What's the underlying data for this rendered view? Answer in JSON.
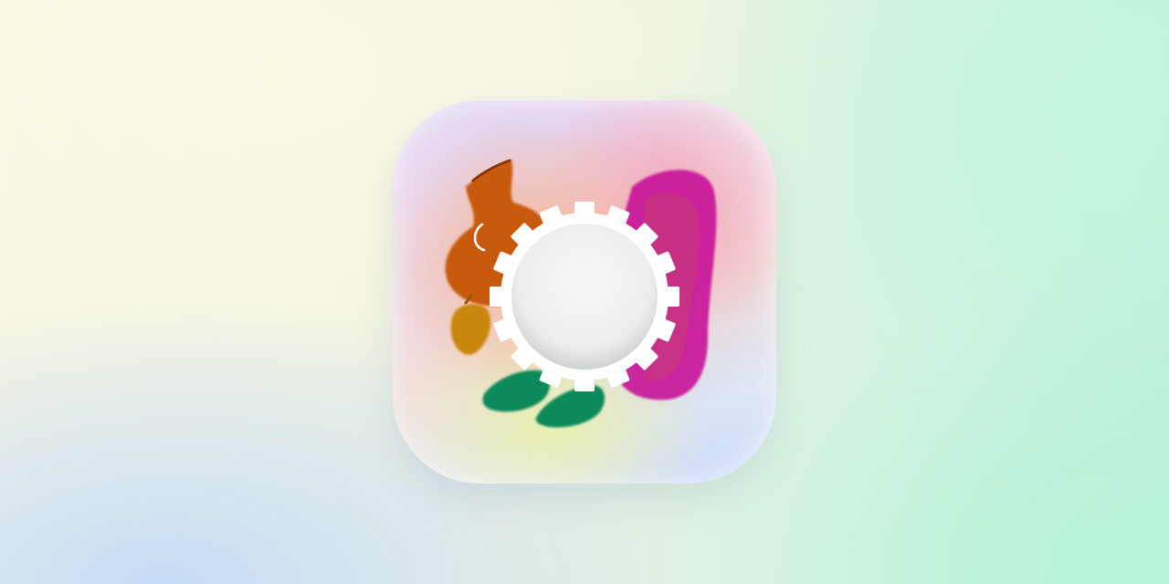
{
  "scene": {
    "background_colors": [
      "#f8f6e2",
      "#c6dcf6",
      "#b9eedb"
    ]
  },
  "app_icon": {
    "icon": "app-icon-squircle",
    "colors": {
      "body_orange": "#c85a0c",
      "wing_magenta": "#c8189a",
      "feet_green": "#0e8a5a",
      "acorn_gold": "#c9880a",
      "gear_white": "#ffffff",
      "center_gray": "#eeefef"
    }
  }
}
